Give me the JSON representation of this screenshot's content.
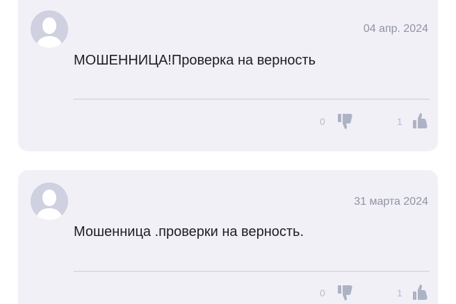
{
  "comments": [
    {
      "date": "04 апр. 2024",
      "text": "МОШЕННИЦА!Проверка на верность",
      "dislikes": "0",
      "likes": "1",
      "avatar_icon": "default-user-avatar"
    },
    {
      "date": "31 марта 2024",
      "text": "Мошенница .проверки на верность.",
      "dislikes": "0",
      "likes": "1",
      "avatar_icon": "default-user-avatar"
    }
  ],
  "colors": {
    "card_background": "#f1f0f7",
    "avatar_background": "#cfd0e0",
    "icon_color": "#aeb2c5",
    "meta_text": "#8f93a3"
  }
}
